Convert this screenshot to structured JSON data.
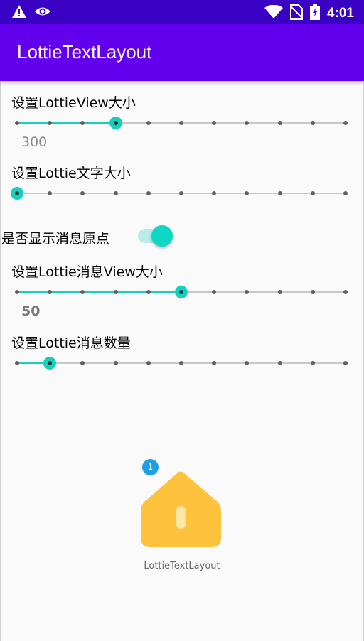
{
  "status_bar": {
    "time": "4:01",
    "icons": [
      "warning-icon",
      "eye-icon",
      "wifi-icon",
      "no-sim-icon",
      "battery-icon"
    ]
  },
  "app_bar": {
    "title": "LottieTextLayout"
  },
  "controls": {
    "view_size_label": "设置LottieView大小",
    "view_size_value": "300",
    "view_size_progress": 0.3,
    "text_size_label": "设置Lottie文字大小",
    "text_size_progress": 0.0,
    "show_dot_label": "是否显示消息原点",
    "show_dot_on": true,
    "msg_view_size_label": "设置Lottie消息View大小",
    "msg_view_size_value": "50",
    "msg_view_size_progress": 0.5,
    "msg_count_label": "设置Lottie消息数量",
    "msg_count_progress": 0.1
  },
  "preview": {
    "badge_count": "1",
    "caption": "LottieTextLayout",
    "house_color": "#ffc23d"
  },
  "colors": {
    "accent": "#17cfbd",
    "primary": "#6200ee",
    "status_bar": "#3a01c4"
  }
}
